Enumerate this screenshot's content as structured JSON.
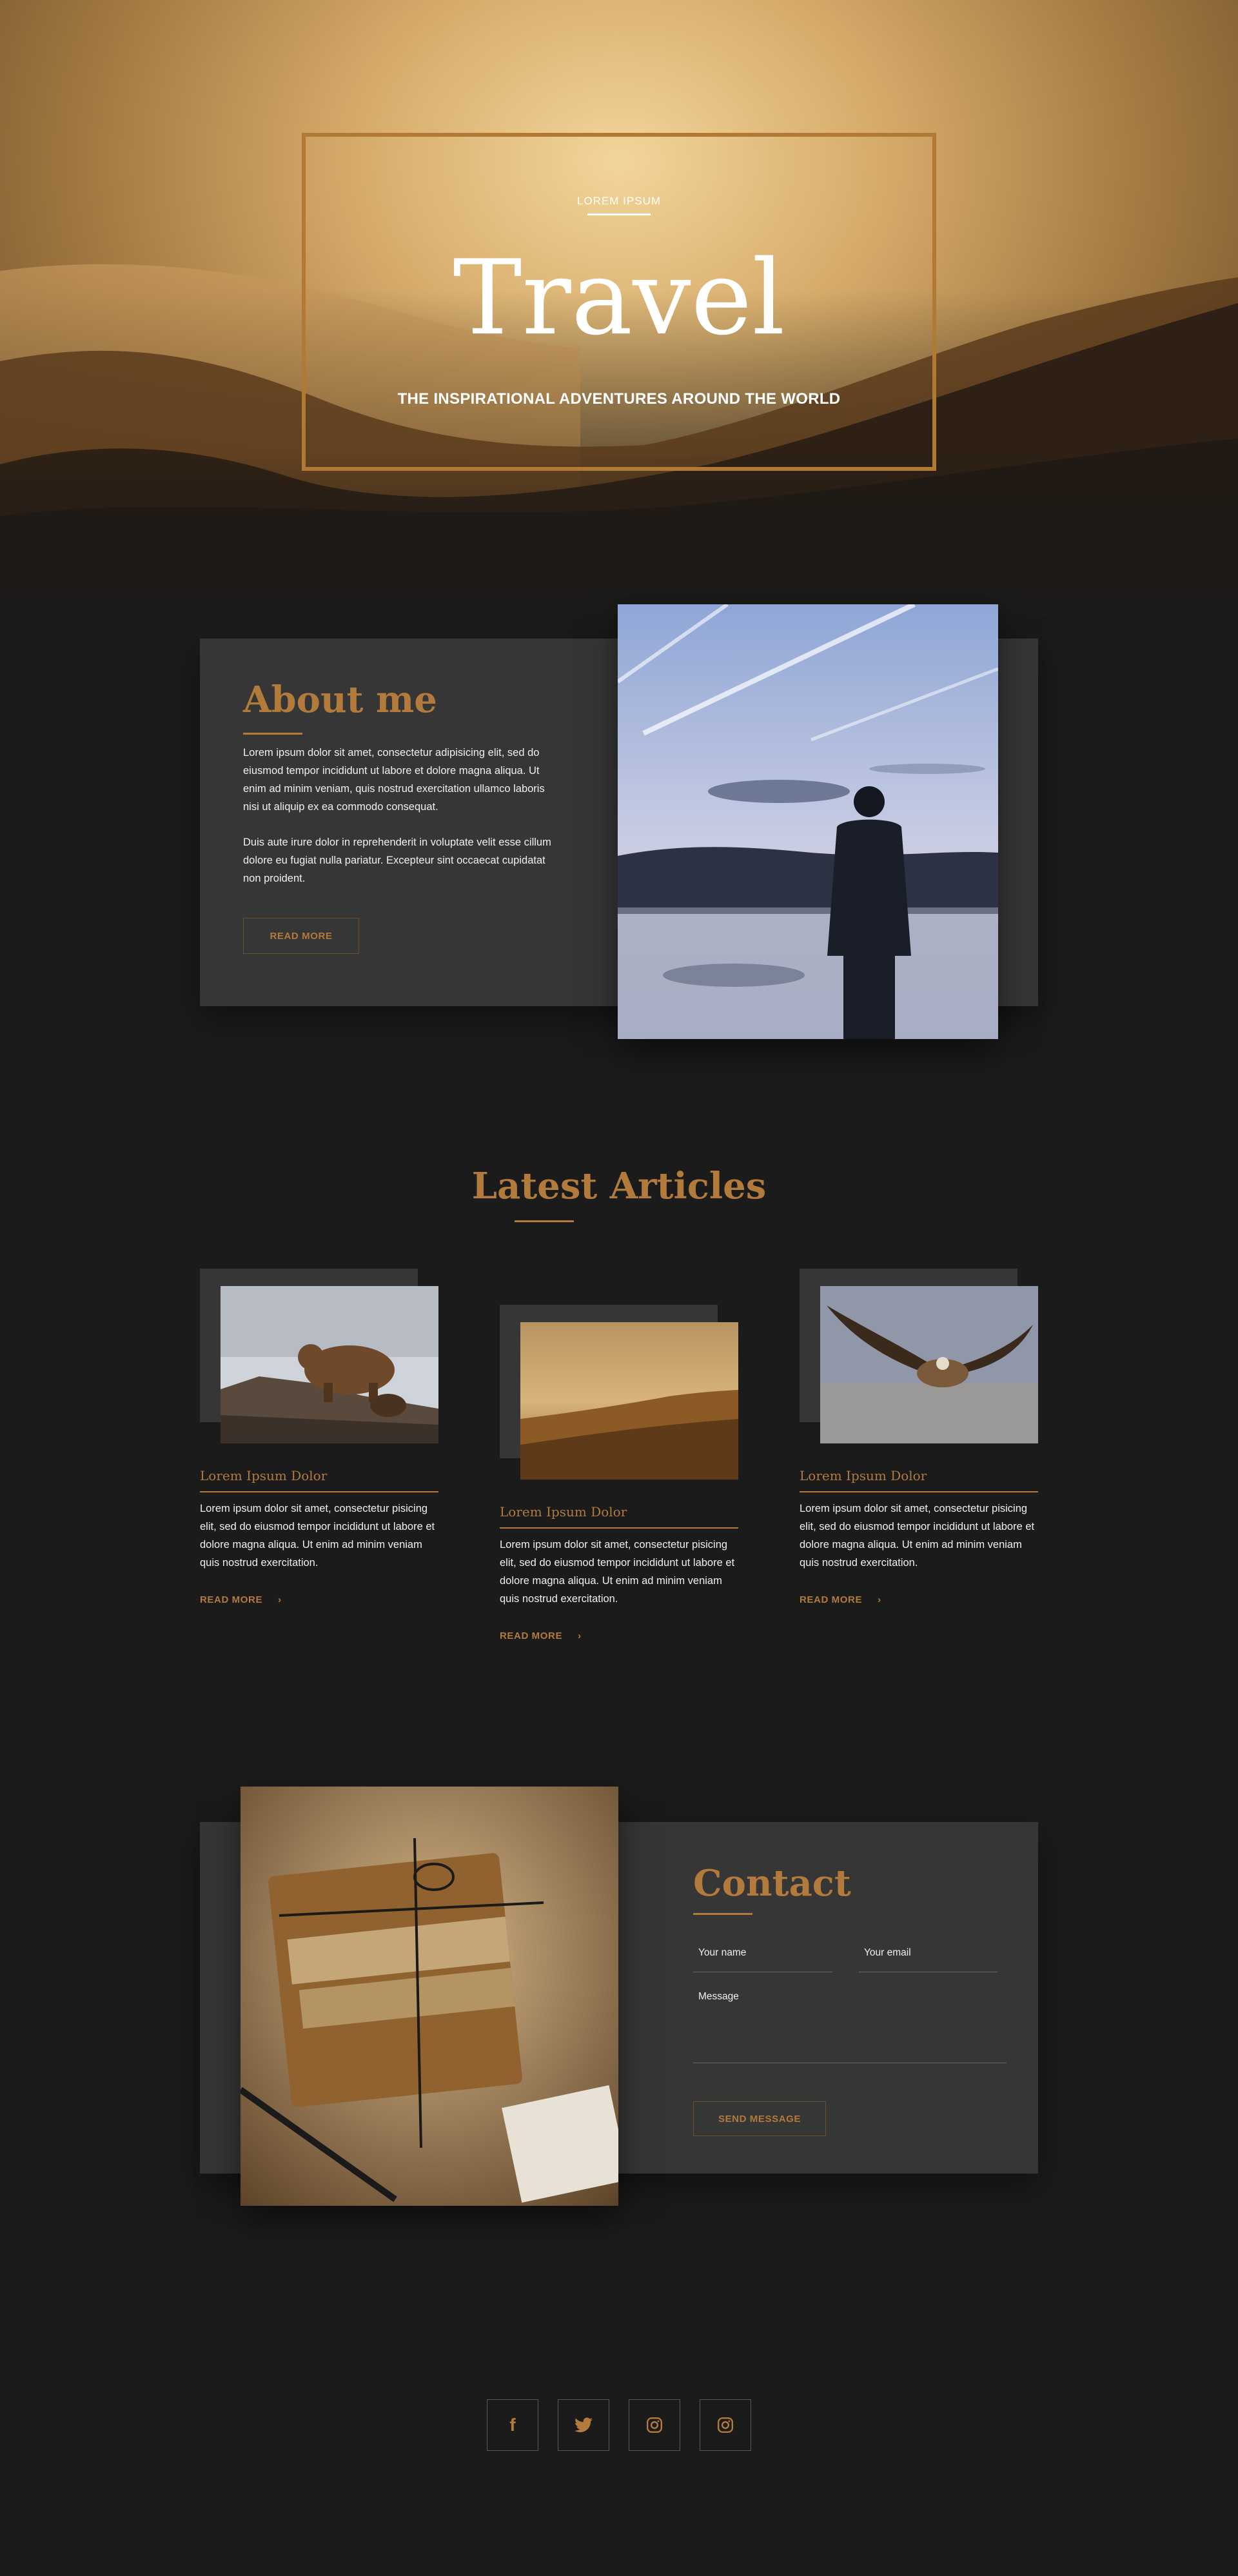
{
  "hero": {
    "kicker": "LOREM IPSUM",
    "title": "Travel",
    "subtitle": "THE INSPIRATIONAL ADVENTURES AROUND THE WORLD"
  },
  "about": {
    "title": "About me",
    "paragraph_1": "Lorem ipsum dolor sit amet, consectetur adipisicing elit, sed do eiusmod tempor incididunt ut labore et dolore magna aliqua. Ut enim ad minim veniam, quis nostrud exercitation ullamco laboris nisi ut aliquip ex ea commodo consequat.",
    "paragraph_2": "Duis aute irure dolor in reprehenderit in voluptate velit esse cillum dolore eu fugiat nulla pariatur. Excepteur sint occaecat cupidatat non proident.",
    "button_label": "READ MORE"
  },
  "articles": {
    "title": "Latest Articles",
    "items": [
      {
        "title": "Lorem Ipsum Dolor",
        "text": "Lorem ipsum dolor sit amet, consectetur pisicing elit, sed do eiusmod tempor incididunt ut labore et dolore magna aliqua. Ut enim ad minim veniam quis nostrud exercitation.",
        "link": "READ MORE",
        "image": "bear-photo"
      },
      {
        "title": "Lorem Ipsum Dolor",
        "text": "Lorem ipsum dolor sit amet, consectetur pisicing elit, sed do eiusmod tempor incididunt ut labore et dolore magna aliqua. Ut enim ad minim veniam quis nostrud exercitation.",
        "link": "READ MORE",
        "image": "forest-photo"
      },
      {
        "title": "Lorem Ipsum Dolor",
        "text": "Lorem ipsum dolor sit amet, consectetur pisicing elit, sed do eiusmod tempor incididunt ut labore et dolore magna aliqua. Ut enim ad minim veniam quis nostrud exercitation.",
        "link": "READ MORE",
        "image": "eagle-photo"
      }
    ]
  },
  "contact": {
    "title": "Contact",
    "name_placeholder": "Your name",
    "email_placeholder": "Your email",
    "message_placeholder": "Message",
    "button_label": "SEND MESSAGE"
  },
  "social": {
    "icons": [
      "facebook-icon",
      "twitter-icon",
      "instagram-icon",
      "instagram-icon"
    ]
  },
  "colors": {
    "accent": "#b27a3b",
    "background": "#1b1b1b",
    "panel": "#363636"
  }
}
